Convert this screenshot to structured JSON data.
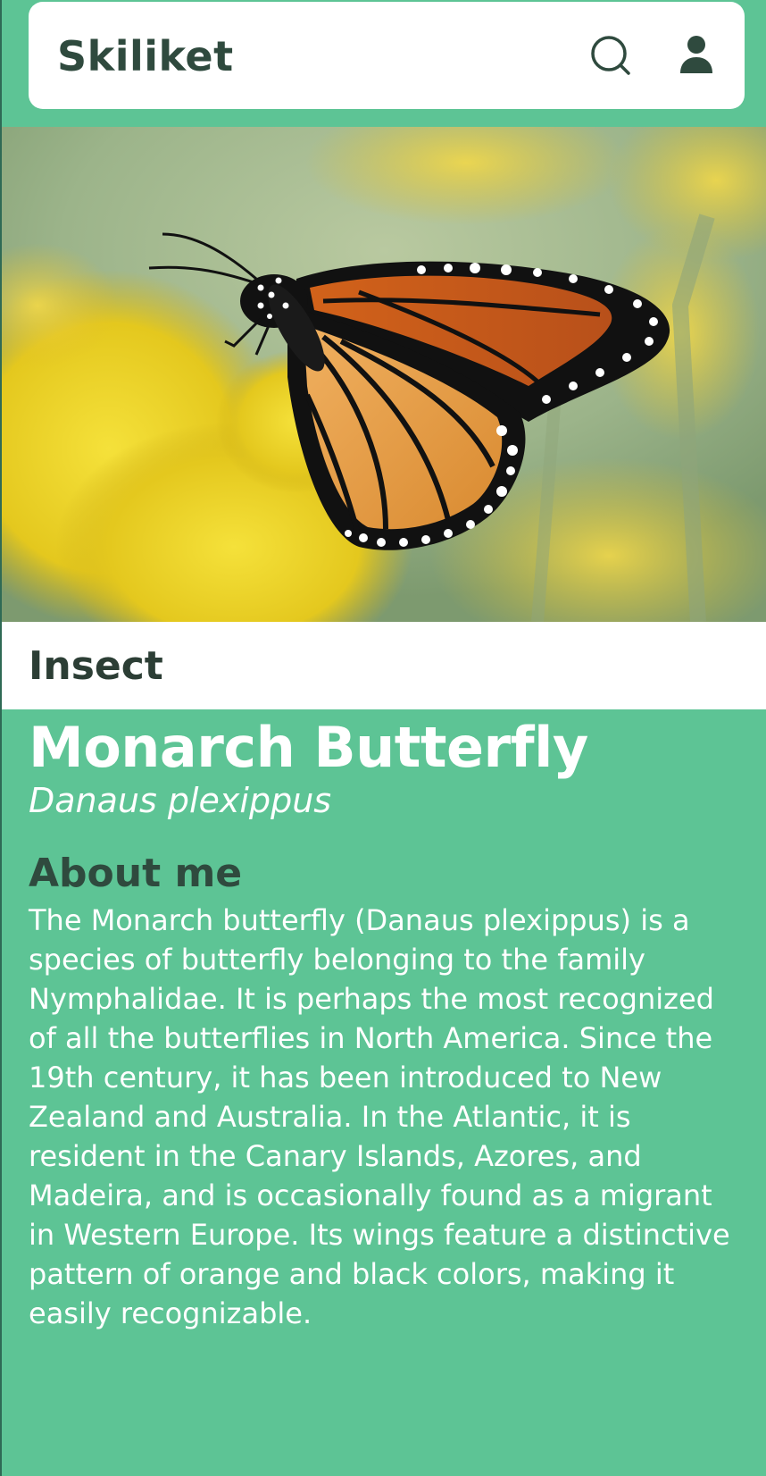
{
  "header": {
    "brand": "Skiliket",
    "search_icon": "search-icon",
    "user_icon": "user-icon"
  },
  "hero": {
    "image_subject": "monarch-butterfly-on-yellow-flowers"
  },
  "species": {
    "category": "Insect",
    "common_name": "Monarch Butterfly",
    "scientific_name": "Danaus plexippus"
  },
  "about": {
    "heading": "About me",
    "body": "The Monarch butterfly (Danaus plexippus) is a species of butterfly belonging to the family Nymphalidae. It is perhaps the most recognized of all the butterflies in North America. Since the 19th century, it has been introduced to New Zealand and Australia. In the Atlantic, it is resident in the Canary Islands, Azores, and Madeira, and is occasionally found as a migrant in Western Europe. Its wings feature a distinctive pattern of orange and black colors, making it easily recognizable."
  },
  "colors": {
    "background": "#5dc495",
    "header_bg": "#ffffff",
    "brand_text": "#2f4a3e",
    "category_text": "#2c3e35"
  }
}
